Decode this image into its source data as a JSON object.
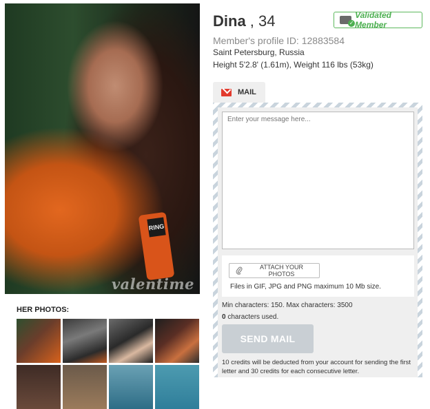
{
  "profile": {
    "name": "Dina",
    "age_sep": " , ",
    "age": "34",
    "validated_label": "Validated Member",
    "profile_id_label": "Member's profile ID: ",
    "profile_id": "12883584",
    "location": "Saint Petersburg, Russia",
    "height_weight": "Height 5'2.8' (1.61m), Weight 116 lbs (53kg)"
  },
  "photos": {
    "watermark": "valentime",
    "wrist_wrap_text": "RING",
    "section_title": "HER PHOTOS:",
    "thumbnails": 8
  },
  "mail": {
    "tab_label": "MAIL",
    "message_placeholder": "Enter your message here...",
    "attach_label": "ATTACH YOUR PHOTOS",
    "files_note": "Files in GIF, JPG and PNG maximum 10 Mb size.",
    "min_max": "Min characters: 150. Max characters: 3500",
    "chars_count": "0",
    "chars_suffix": " characters used.",
    "send_label": "SEND MAIL",
    "credits_note": "10 credits will be deducted from your account for sending the first letter and 30 credits for each consecutive letter."
  },
  "colors": {
    "validated_green": "#4caf50",
    "mail_icon_red": "#e23b2e",
    "send_button_disabled": "#c9cfd4",
    "panel_stripe": "#c9d4dd"
  },
  "icons": [
    "validated-badge-icon",
    "envelope-icon",
    "paperclip-icon"
  ]
}
